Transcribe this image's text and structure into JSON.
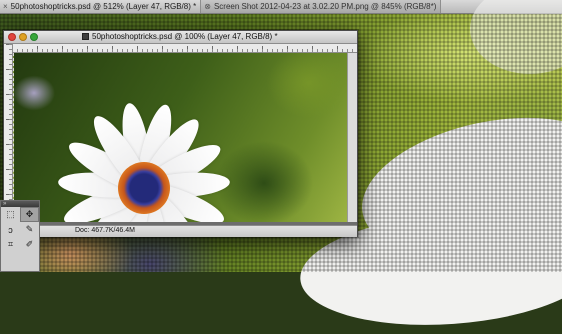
{
  "tabs": [
    {
      "close": "×",
      "label": "50photoshoptricks.psd @ 512% (Layer 47, RGB/8) *",
      "active": true
    },
    {
      "close": "⊗",
      "label": "Screen Shot 2012-04-23 at 3.02.20 PM.png @ 845% (RGB/8*)",
      "active": false
    }
  ],
  "document": {
    "title": "50photoshoptricks.psd @ 100% (Layer 47, RGB/8) *",
    "status": "Doc: 467.7K/46.4M"
  },
  "tools_panel": {
    "collapse": "»",
    "tools": [
      {
        "name": "marquee-tool",
        "glyph": "⬚",
        "selected": false
      },
      {
        "name": "move-tool",
        "glyph": "✥",
        "selected": true
      },
      {
        "name": "lasso-tool",
        "glyph": "ↄ",
        "selected": false
      },
      {
        "name": "quick-select-tool",
        "glyph": "✎",
        "selected": false
      },
      {
        "name": "crop-tool",
        "glyph": "⌗",
        "selected": false
      },
      {
        "name": "eyedropper-tool",
        "glyph": "✐",
        "selected": false
      }
    ]
  },
  "colors": {
    "close_red": "#e0443e",
    "minimize_yellow": "#dea123",
    "zoom_green": "#37a63a"
  }
}
